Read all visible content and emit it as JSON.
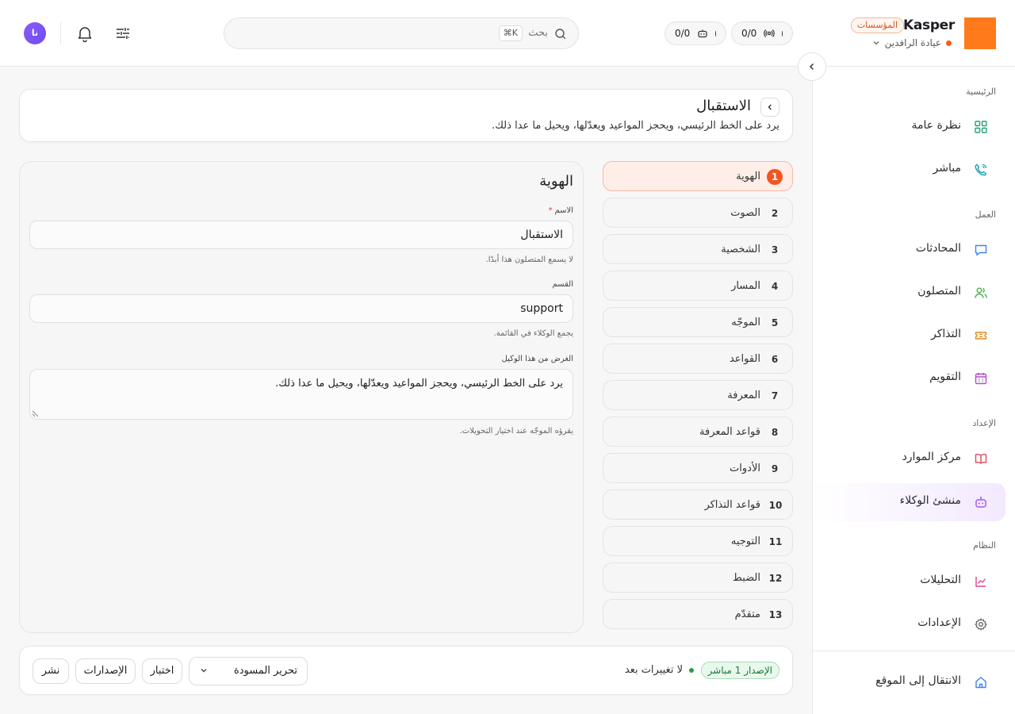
{
  "brand": {
    "name": "Kasper",
    "badge": "المؤسسات",
    "clinic": "عيادة الرافدين",
    "logo_color": "#ff7a1a"
  },
  "top": {
    "pill_calls": {
      "count": "0/0",
      "icon": "radio-icon"
    },
    "pill_agents": {
      "count": "0/0",
      "icon": "bot-icon"
    },
    "search": {
      "placeholder": "بحث",
      "shortcut": "⌘K"
    },
    "avatar_initials": "نا"
  },
  "sidebar": {
    "sections": [
      {
        "title": "الرئيسية"
      },
      {
        "title": "العمل"
      },
      {
        "title": "الإعداد"
      },
      {
        "title": "النظام"
      }
    ],
    "items": [
      {
        "label": "نظرة عامة",
        "icon": "grid-icon"
      },
      {
        "label": "مباشر",
        "icon": "phone-icon"
      },
      {
        "label": "المحادثات",
        "icon": "chat-icon"
      },
      {
        "label": "المتصلون",
        "icon": "users-icon"
      },
      {
        "label": "التذاكر",
        "icon": "ticket-icon"
      },
      {
        "label": "التقويم",
        "icon": "calendar-icon"
      },
      {
        "label": "مركز الموارد",
        "icon": "book-icon"
      },
      {
        "label": "منشئ الوكلاء",
        "icon": "bot-icon"
      },
      {
        "label": "التحليلات",
        "icon": "chart-icon"
      },
      {
        "label": "الإعدادات",
        "icon": "gear-icon"
      }
    ],
    "footer": {
      "label": "الانتقال إلى الموقع",
      "icon": "home-icon"
    }
  },
  "header": {
    "title": "الاستقبال",
    "subtitle": "يرد على الخط الرئيسي، ويحجز المواعيد ويعدّلها، ويحيل ما عدا ذلك."
  },
  "steps": [
    {
      "num": "1",
      "label": "الهوية"
    },
    {
      "num": "2",
      "label": "الصوت"
    },
    {
      "num": "3",
      "label": "الشخصية"
    },
    {
      "num": "4",
      "label": "المسار"
    },
    {
      "num": "5",
      "label": "الموجّه"
    },
    {
      "num": "6",
      "label": "القواعد"
    },
    {
      "num": "7",
      "label": "المعرفة"
    },
    {
      "num": "8",
      "label": "قواعد المعرفة"
    },
    {
      "num": "9",
      "label": "الأدوات"
    },
    {
      "num": "10",
      "label": "قواعد التذاكر"
    },
    {
      "num": "11",
      "label": "التوجيه"
    },
    {
      "num": "12",
      "label": "الضبط"
    },
    {
      "num": "13",
      "label": "متقدّم"
    }
  ],
  "identity": {
    "title": "الهوية",
    "name_label": "الاسم",
    "required_mark": "*",
    "name_value": "الاستقبال",
    "name_hint": "لا يسمع المتصلون هذا أبدًا.",
    "dept_label": "القسم",
    "dept_value": "support",
    "dept_hint": "يجمع الوكلاء في القائمة.",
    "purpose_label": "الغرض من هذا الوكيل",
    "purpose_value": "يرد على الخط الرئيسي، ويحجز المواعيد ويعدّلها، ويحيل ما عدا ذلك.",
    "purpose_hint": "يقرؤه الموجّه عند اختيار التحويلات."
  },
  "footer": {
    "version_badge": "الإصدار 1 مباشر",
    "status": "لا تغييرات بعد",
    "mode_select": "تحرير المسودة",
    "test_button": "اختبار",
    "versions_button": "الإصدارات",
    "publish_button": "نشر"
  },
  "colors": {
    "accent": "#f4541f",
    "live": "#24a148",
    "active_nav": "#a855f7"
  }
}
